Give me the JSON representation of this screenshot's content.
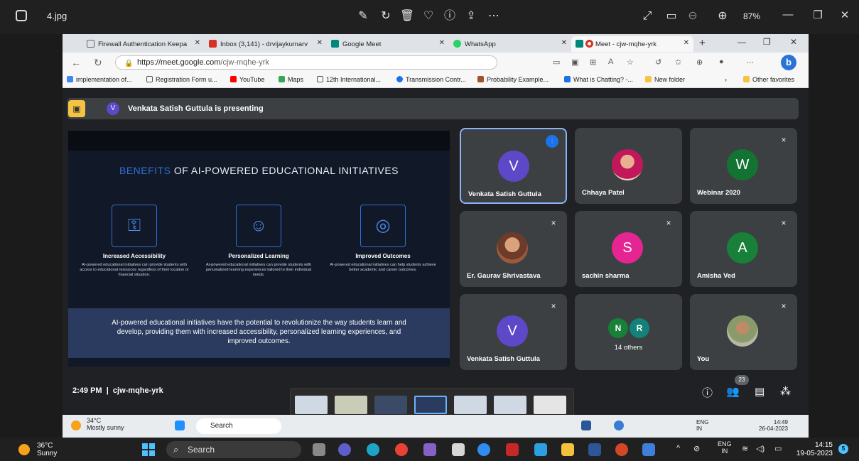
{
  "viewer": {
    "filename": "4.jpg",
    "zoom": "87%"
  },
  "browser": {
    "tabs": [
      {
        "label": "Firewall Authentication Keepa",
        "icon_color": "#666666"
      },
      {
        "label": "Inbox (3,141) - drvijaykumarv",
        "icon_color": "#d93025"
      },
      {
        "label": "Google Meet",
        "icon_color": "#00897b"
      },
      {
        "label": "WhatsApp",
        "icon_color": "#25d366"
      },
      {
        "label": "Meet - cjw-mqhe-yrk",
        "icon_color": "#00897b"
      }
    ],
    "url_host": "https://meet.google.com",
    "url_path": "/cjw-mqhe-yrk",
    "bookmarks": [
      {
        "label": "implementation of...",
        "icon_color": "#4285f4"
      },
      {
        "label": "Registration Form u...",
        "icon_color": "#555555"
      },
      {
        "label": "YouTube",
        "icon_color": "#ff0000"
      },
      {
        "label": "Maps",
        "icon_color": "#34a853"
      },
      {
        "label": "12th International...",
        "icon_color": "#555555"
      },
      {
        "label": "Transmission Contr...",
        "icon_color": "#1a73e8"
      },
      {
        "label": "Probability Example...",
        "icon_color": "#a0522d"
      },
      {
        "label": "What is Chatting? -...",
        "icon_color": "#1a73e8"
      },
      {
        "label": "New folder",
        "icon_color": "#f6c342"
      },
      {
        "label": "Other favorites",
        "icon_color": "#f6c342"
      }
    ]
  },
  "meet": {
    "presenting": "Venkata Satish Guttula is presenting",
    "presenter_initial": "V",
    "time": "2:49 PM",
    "meeting_code": "cjw-mqhe-yrk",
    "participants_count": "23",
    "tiles": [
      {
        "initial": "V",
        "name": "Venkata Satish Guttula",
        "color": "#5d48c8"
      },
      {
        "initial": "",
        "name": "Chhaya Patel",
        "color": "#c2185b"
      },
      {
        "initial": "W",
        "name": "Webinar 2020",
        "color": "#137333"
      },
      {
        "initial": "",
        "name": "Er. Gaurav Shrivastava",
        "color": "#795548"
      },
      {
        "initial": "S",
        "name": "sachin sharma",
        "color": "#e52592"
      },
      {
        "initial": "A",
        "name": "Amisha Ved",
        "color": "#188038"
      },
      {
        "initial": "V",
        "name": "Venkata Satish Guttula",
        "color": "#5d48c8"
      },
      {
        "initial": "",
        "name": "14 others",
        "color": "#3c4043"
      },
      {
        "initial": "",
        "name": "You",
        "color": "#6d4c41"
      }
    ],
    "others_initials": [
      "N",
      "R"
    ]
  },
  "slide": {
    "title_highlight": "BENEFITS",
    "title_rest": " OF AI-POWERED EDUCATIONAL INITIATIVES",
    "features": [
      {
        "name": "Increased Accessibility",
        "desc": "AI-powered educational initiatives can provide students with access to educational resources regardless of their location or financial situation."
      },
      {
        "name": "Personalized Learning",
        "desc": "AI-powered educational initiatives can provide students with personalized learning experiences tailored to their individual needs."
      },
      {
        "name": "Improved Outcomes",
        "desc": "AI-powered educational initiatives can help students achieve better academic and career outcomes."
      }
    ],
    "banner": "AI-powered educational initiatives have the potential to revolutionize the way students learn and develop, providing them with increased accessibility, personalized learning experiences, and improved outcomes."
  },
  "inner_taskbar": {
    "temp": "34°C",
    "weather": "Mostly sunny",
    "search": "Search",
    "lang": "ENG",
    "region": "IN",
    "time": "14:49",
    "date": "26-04-2023"
  },
  "taskbar": {
    "temp": "36°C",
    "weather": "Sunny",
    "search": "Search",
    "lang": "ENG",
    "region": "IN",
    "time": "14:15",
    "date": "19-05-2023",
    "notifications": "5"
  }
}
